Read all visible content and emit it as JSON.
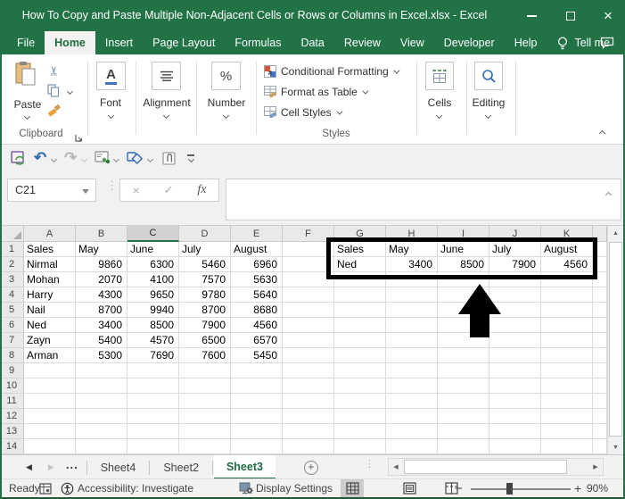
{
  "colors": {
    "excel_green": "#217346",
    "active_sheet_text": "#1e6b41",
    "highlight_border": "#000000"
  },
  "window": {
    "title": "How To Copy and Paste Multiple Non-Adjacent Cells or Rows or Columns in Excel.xlsx  -  Excel",
    "controls": [
      "minimize",
      "maximize",
      "close"
    ]
  },
  "menu": {
    "tabs": [
      {
        "label": "File"
      },
      {
        "label": "Home",
        "active": true
      },
      {
        "label": "Insert"
      },
      {
        "label": "Page Layout"
      },
      {
        "label": "Formulas"
      },
      {
        "label": "Data"
      },
      {
        "label": "Review"
      },
      {
        "label": "View"
      },
      {
        "label": "Developer"
      },
      {
        "label": "Help"
      }
    ],
    "tell_me": "Tell me"
  },
  "ribbon": {
    "paste_label": "Paste",
    "clipboard_label": "Clipboard",
    "font_label": "Font",
    "alignment_label": "Alignment",
    "number_label": "Number",
    "styles_items": [
      "Conditional Formatting",
      "Format as Table",
      "Cell Styles"
    ],
    "styles_label": "Styles",
    "cells_label": "Cells",
    "editing_label": "Editing"
  },
  "quick_access": {
    "icons": [
      "save-sync",
      "undo",
      "redo",
      "share",
      "draw-shapes",
      "touch-clip",
      "customize-quick-access"
    ]
  },
  "formula_bar": {
    "name_box": "C21",
    "fx_label": "fx",
    "value": ""
  },
  "grid": {
    "columns": [
      "A",
      "B",
      "C",
      "D",
      "E",
      "F",
      "G",
      "H",
      "I",
      "J",
      "K"
    ],
    "row_count": 14,
    "selected_cell": "C21",
    "selected_column": "C",
    "tables": [
      {
        "origin": "A1",
        "rows": [
          [
            "Sales",
            "May",
            "June",
            "July",
            "August"
          ],
          [
            "Nirmal",
            9860,
            6300,
            5460,
            6960
          ],
          [
            "Mohan",
            2070,
            4100,
            7570,
            5630
          ],
          [
            "Harry",
            4300,
            9650,
            9780,
            5640
          ],
          [
            "Nail",
            8700,
            9940,
            8700,
            8680
          ],
          [
            "Ned",
            3400,
            8500,
            7900,
            4560
          ],
          [
            "Zayn",
            5400,
            4570,
            6500,
            6570
          ],
          [
            "Arman",
            5300,
            7690,
            7600,
            5450
          ]
        ]
      },
      {
        "origin": "G1",
        "rows": [
          [
            "Sales",
            "May",
            "June",
            "July",
            "August"
          ],
          [
            "Ned",
            3400,
            8500,
            7900,
            4560
          ]
        ]
      }
    ],
    "annotation": {
      "highlight_range": "G1:K2",
      "arrow": "black-up-arrow"
    }
  },
  "sheets": {
    "ellipsis": "...",
    "tabs": [
      {
        "label": "Sheet4"
      },
      {
        "label": "Sheet2"
      },
      {
        "label": "Sheet3",
        "active": true
      }
    ]
  },
  "status_bar": {
    "ready": "Ready",
    "accessibility": "Accessibility: Investigate",
    "display_settings": "Display Settings",
    "zoom_level": "90%"
  }
}
